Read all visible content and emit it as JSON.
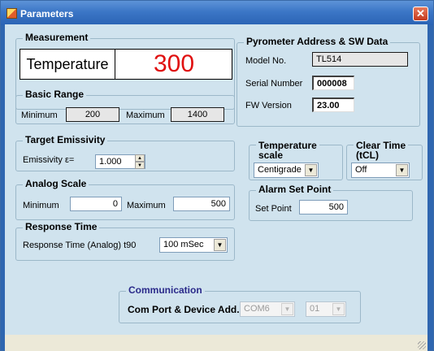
{
  "window": {
    "title": "Parameters",
    "close_glyph": "✕"
  },
  "measurement": {
    "legend": "Measurement",
    "label": "Temperature",
    "value": "300",
    "value_color": "#e01010"
  },
  "basic_range": {
    "legend": "Basic Range",
    "min_label": "Minimum",
    "min_value": "200",
    "max_label": "Maximum",
    "max_value": "1400"
  },
  "target_emissivity": {
    "legend": "Target Emissivity",
    "label": "Emissivity ε=",
    "value": "1.000"
  },
  "analog_scale": {
    "legend": "Analog Scale",
    "min_label": "Minimum",
    "min_value": "0",
    "max_label": "Maximum",
    "max_value": "500"
  },
  "response_time": {
    "legend": "Response Time",
    "label": "Response Time  (Analog)  t90",
    "selected": "100 mSec"
  },
  "pyrometer": {
    "legend": "Pyrometer Address & SW Data",
    "model_label": "Model No.",
    "model_value": "TL514",
    "serial_label": "Serial Number",
    "serial_value": "000008",
    "fw_label": "FW Version",
    "fw_value": "23.00"
  },
  "temperature_scale": {
    "legend_line1": "Temperature",
    "legend_line2": "scale",
    "selected": "Centigrade"
  },
  "clear_time": {
    "legend_line1": "Clear Time",
    "legend_line2": "(tCL)",
    "selected": "Off"
  },
  "alarm": {
    "legend": "Alarm Set Point",
    "label": "Set Point",
    "value": "500"
  },
  "communication": {
    "legend": "Communication",
    "label": "Com Port & Device Add.",
    "port": "COM6",
    "address": "01"
  },
  "icons": {
    "app": "app-icon",
    "close": "close-icon",
    "dropdown": "chevron-down-icon",
    "spin": "spin-arrows-icon"
  }
}
